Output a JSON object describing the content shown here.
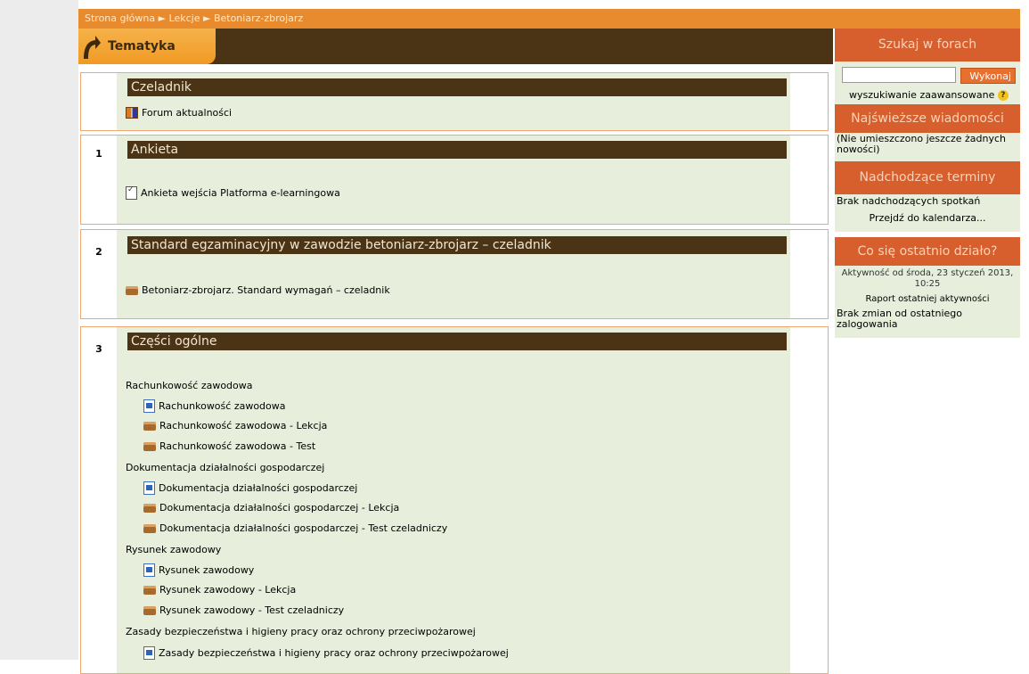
{
  "breadcrumb": {
    "home": "Strona główna",
    "sep1": "►",
    "lessons": "Lekcje",
    "sep2": "►",
    "current": "Betoniarz-zbrojarz"
  },
  "header": {
    "title": "Tematyka"
  },
  "sections": {
    "s0": {
      "title": "Czeladnik",
      "forum": "Forum aktualności"
    },
    "s1": {
      "num": "1",
      "title": "Ankieta",
      "item": "Ankieta wejścia Platforma e-learningowa"
    },
    "s2": {
      "num": "2",
      "title": "Standard egzaminacyjny w zawodzie betoniarz-zbrojarz – czeladnik",
      "item": "Betoniarz-zbrojarz. Standard wymagań – czeladnik"
    },
    "s3": {
      "num": "3",
      "title": "Części ogólne",
      "groups": [
        {
          "label": "Rachunkowość zawodowa",
          "items": [
            "Rachunkowość zawodowa",
            "Rachunkowość zawodowa - Lekcja",
            "Rachunkowość zawodowa - Test"
          ]
        },
        {
          "label": "Dokumentacja działalności gospodarczej",
          "items": [
            "Dokumentacja działalności gospodarczej",
            "Dokumentacja działalności gospodarczej - Lekcja",
            "Dokumentacja działalności gospodarczej - Test czeladniczy"
          ]
        },
        {
          "label": "Rysunek zawodowy",
          "items": [
            "Rysunek zawodowy",
            "Rysunek zawodowy - Lekcja",
            "Rysunek zawodowy - Test czeladniczy"
          ]
        },
        {
          "label": "Zasady bezpieczeństwa i higieny pracy oraz ochrony przeciwpożarowej",
          "items": [
            "Zasady bezpieczeństwa i higieny pracy oraz ochrony przeciwpożarowej"
          ]
        }
      ]
    }
  },
  "sidebar": {
    "search": {
      "title": "Szukaj w forach",
      "button": "Wykonaj",
      "advanced": "wyszukiwanie zaawansowane",
      "value": ""
    },
    "news": {
      "title": "Najświeższe wiadomości",
      "empty": "(Nie umieszczono jeszcze żadnych nowości)"
    },
    "events": {
      "title": "Nadchodzące terminy",
      "none": "Brak nadchodzących spotkań",
      "calendar": "Przejdź do kalendarza..."
    },
    "recent": {
      "title": "Co się ostatnio działo?",
      "since": "Aktywność od środa, 23 styczeń 2013, 10:25",
      "report": "Raport ostatniej aktywności",
      "none": "Brak zmian od ostatniego zalogowania"
    }
  },
  "colors": {
    "accent": "#e88a2e",
    "header_dark": "#4b3416",
    "block_head": "#d75f2d",
    "content_bg": "#e7efdc"
  }
}
